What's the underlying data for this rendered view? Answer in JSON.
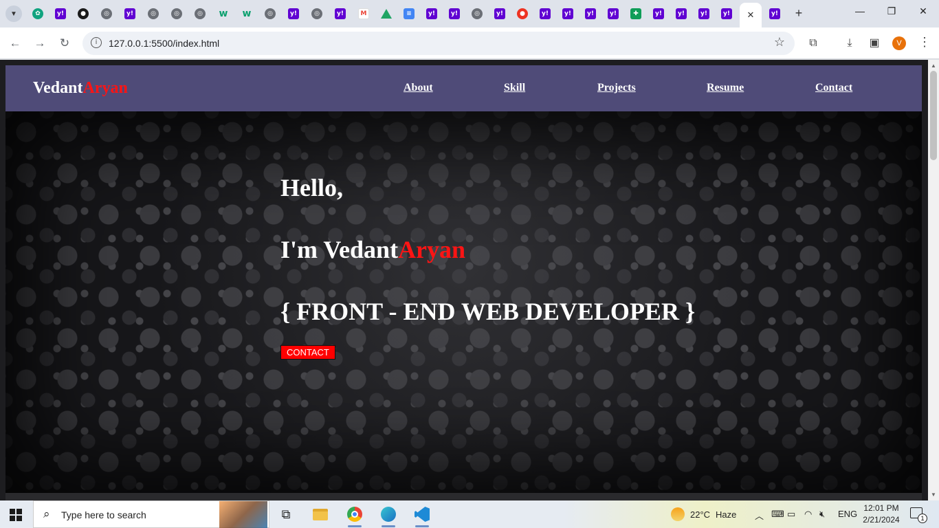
{
  "browser": {
    "url": "127.0.0.1:5500/index.html",
    "profile_initial": "V",
    "tab_favicons": [
      "chatgpt-icon",
      "yahoo-icon",
      "github-icon",
      "globe-icon",
      "yahoo-icon",
      "globe-icon",
      "globe-icon",
      "globe-icon",
      "w-icon",
      "w-icon",
      "globe-icon",
      "yahoo-icon",
      "globe-icon",
      "yahoo-icon",
      "gmail-icon",
      "drive-icon",
      "docs-icon",
      "yahoo-icon",
      "yahoo-icon",
      "globe-icon",
      "yahoo-icon",
      "record-icon",
      "yahoo-icon",
      "yahoo-icon",
      "yahoo-icon",
      "yahoo-icon",
      "sheets-icon",
      "yahoo-icon",
      "yahoo-icon",
      "yahoo-icon",
      "yahoo-icon"
    ]
  },
  "site": {
    "logo_first": "Vedant",
    "logo_second": "Aryan",
    "nav": [
      "About",
      "Skill",
      "Projects",
      "Resume",
      "Contact"
    ],
    "hero": {
      "greeting": "Hello,",
      "intro_prefix": "I'm Vedant",
      "intro_name_accent": "Aryan",
      "role": "{ FRONT - END WEB DEVELOPER }",
      "cta": "CONTACT"
    },
    "colors": {
      "nav_bg": "#4f4b78",
      "accent": "#ff1414"
    }
  },
  "taskbar": {
    "search_placeholder": "Type here to search",
    "weather_temp": "22°C",
    "weather_desc": "Haze",
    "language": "ENG",
    "time": "12:01 PM",
    "date": "2/21/2024",
    "notification_count": "1"
  }
}
